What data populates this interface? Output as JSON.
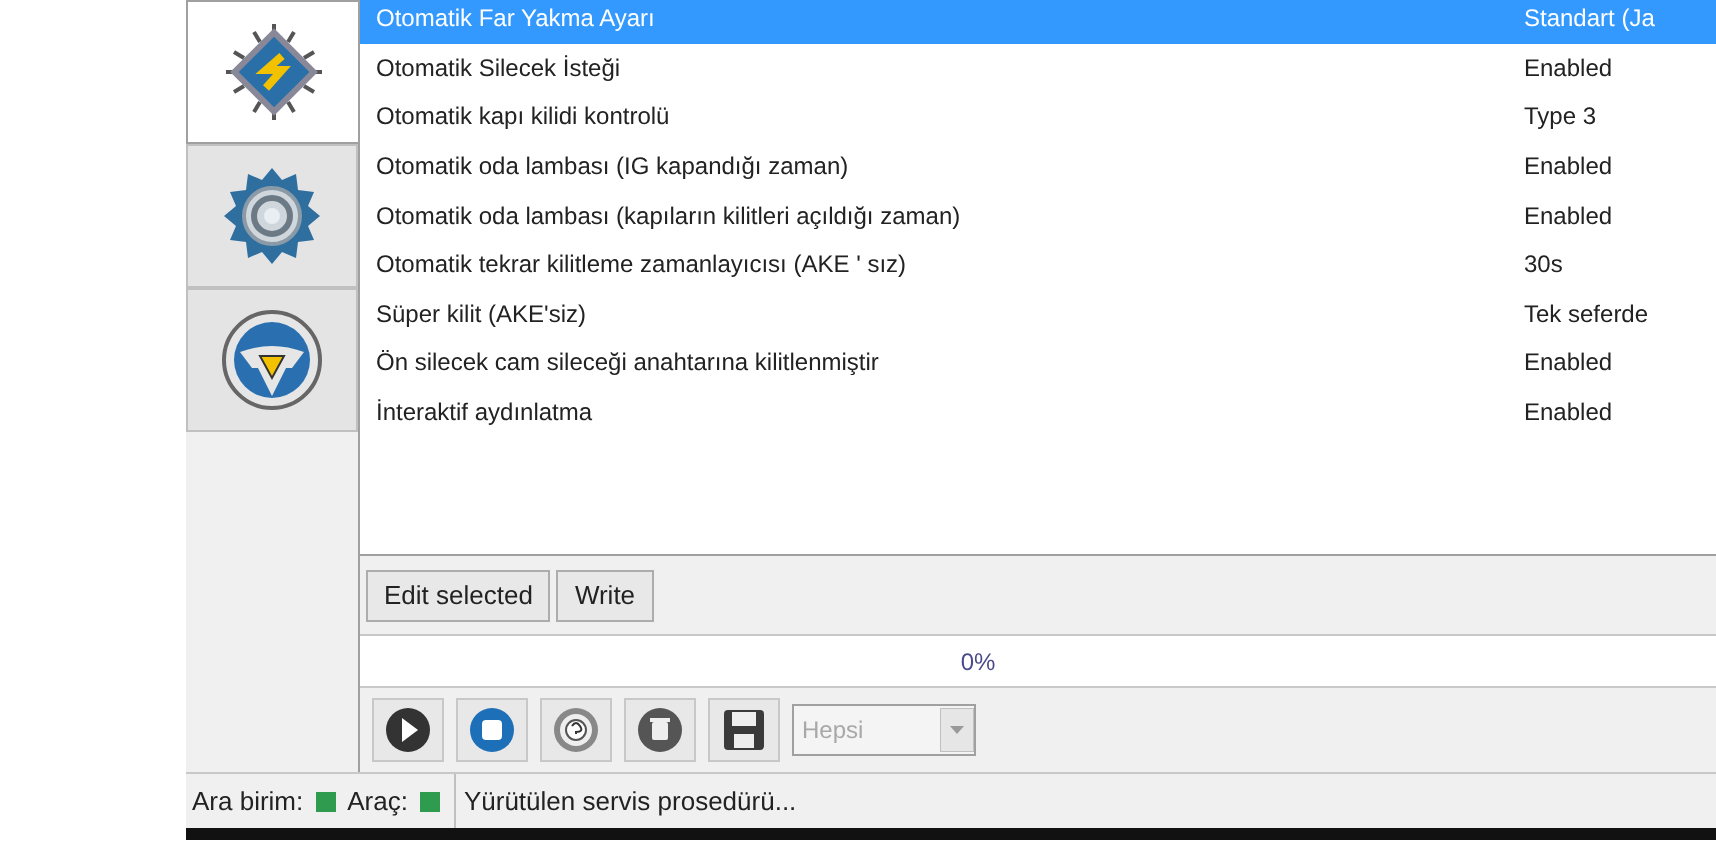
{
  "side_tabs": [
    {
      "kind": "chip",
      "selected": true
    },
    {
      "kind": "gear",
      "selected": false
    },
    {
      "kind": "steering",
      "selected": false
    }
  ],
  "settings": [
    {
      "name": "Otomatik Far Yakma Ayarı",
      "value": "Standart (Ja",
      "selected": true
    },
    {
      "name": "Otomatik Silecek İsteği",
      "value": "Enabled",
      "selected": false
    },
    {
      "name": "Otomatik kapı kilidi kontrolü",
      "value": "Type 3",
      "selected": false
    },
    {
      "name": "Otomatik oda lambası (IG kapandığı zaman)",
      "value": "Enabled",
      "selected": false
    },
    {
      "name": "Otomatik oda lambası (kapıların kilitleri açıldığı zaman)",
      "value": "Enabled",
      "selected": false
    },
    {
      "name": "Otomatik tekrar kilitleme zamanlayıcısı (AKE ' sız)",
      "value": "30s",
      "selected": false
    },
    {
      "name": "Süper kilit (AKE'siz)",
      "value": "Tek seferde",
      "selected": false
    },
    {
      "name": "Ön silecek cam sileceği anahtarına kilitlenmiştir",
      "value": "Enabled",
      "selected": false
    },
    {
      "name": "İnteraktif aydınlatma",
      "value": "Enabled",
      "selected": false
    }
  ],
  "buttons": [
    "Edit selected",
    "Write"
  ],
  "progress": {
    "level": 0,
    "text": "0%"
  },
  "toolbar": [
    {
      "kind": "play"
    },
    {
      "kind": "stop"
    },
    {
      "kind": "help"
    },
    {
      "kind": "delete"
    },
    {
      "kind": "save"
    }
  ],
  "filter": {
    "value": "Hepsi",
    "disabled": true
  },
  "status_bar": {
    "indicators": [
      {
        "label": "Ara birim:",
        "color": "#2e9b4e"
      },
      {
        "label": "Araç:",
        "color": "#2e9b4e"
      }
    ],
    "message": "Yürütülen servis prosedürü..."
  }
}
